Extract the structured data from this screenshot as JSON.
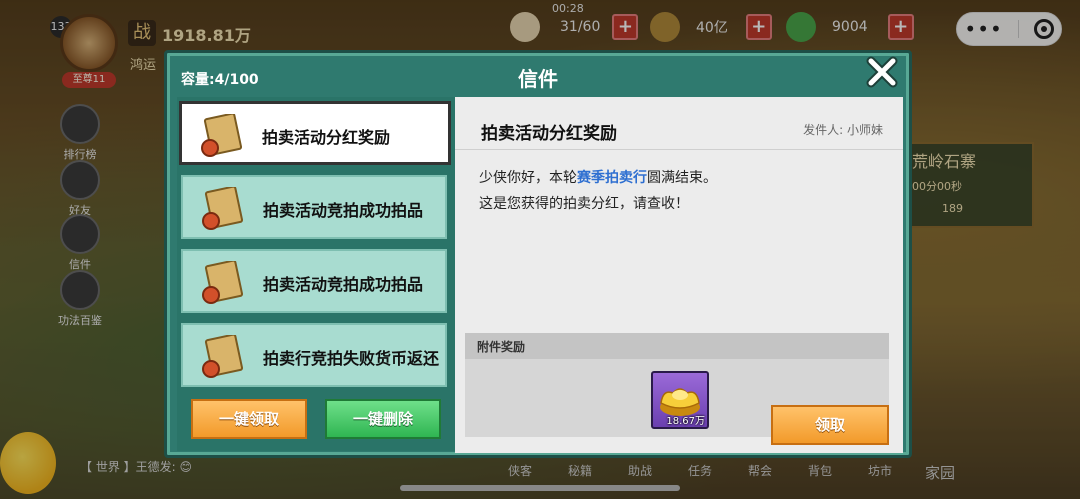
{
  "hud": {
    "level": "133",
    "vip": "至尊11",
    "power": "1918.81万",
    "luck_label": "鸿运",
    "timer": "00:28",
    "res1": "31/60",
    "res2": "40亿",
    "res3": "9004"
  },
  "side_menu": [
    "排行榜",
    "好友",
    "信件",
    "功法百鉴"
  ],
  "right_cards": {
    "event_title": "荒岭石寨",
    "event_time": "00分00秒",
    "event_count": "189"
  },
  "bottom_nav": [
    "侠客",
    "秘籍",
    "助战",
    "任务",
    "帮会",
    "背包",
    "坊市",
    "家园"
  ],
  "chat": {
    "channel": "【 世界 】王德发:",
    "emoji": "😊"
  },
  "mail": {
    "title": "信件",
    "capacity": "容量:4/100",
    "items": [
      {
        "label": "拍卖活动分红奖励"
      },
      {
        "label": "拍卖活动竞拍成功拍品"
      },
      {
        "label": "拍卖活动竞拍成功拍品"
      },
      {
        "label": "拍卖行竞拍失败货币返还"
      }
    ],
    "claim_all": "一键领取",
    "delete_all": "一键删除",
    "detail": {
      "subject": "拍卖活动分红奖励",
      "sender": "发件人: 小师妹",
      "line1_pre": "少侠你好，本轮",
      "line1_hl": "赛季拍卖行",
      "line1_post": "圆满结束。",
      "line2": "这是您获得的拍卖分红，请查收！",
      "attach_title": "附件奖励",
      "reward_qty": "18.67万",
      "claim": "领取"
    }
  }
}
